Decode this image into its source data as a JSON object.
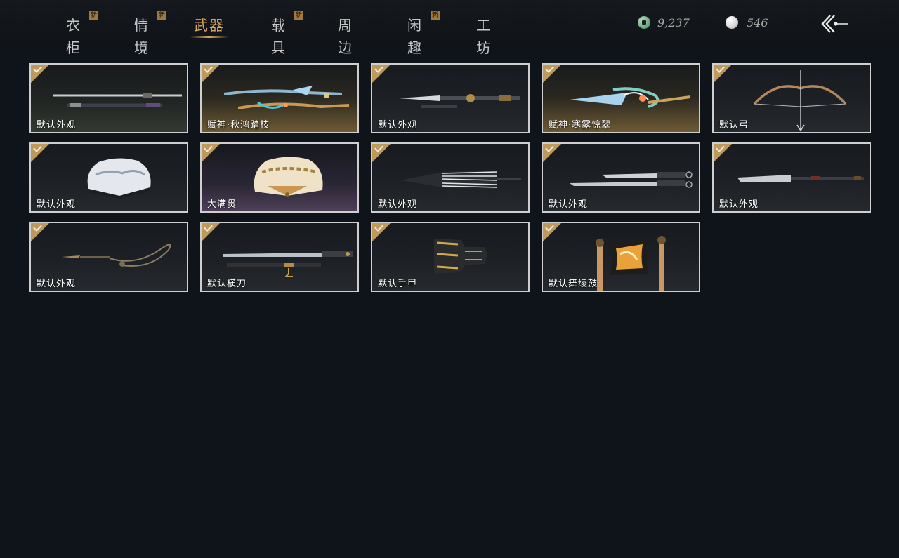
{
  "nav": {
    "tabs": [
      {
        "label": "衣柜",
        "new": true,
        "active": false
      },
      {
        "label": "情境",
        "new": true,
        "active": false
      },
      {
        "label": "武器",
        "new": false,
        "active": true
      },
      {
        "label": "载具",
        "new": true,
        "active": false
      },
      {
        "label": "周边",
        "new": false,
        "active": false
      },
      {
        "label": "闲趣",
        "new": true,
        "active": false
      },
      {
        "label": "工坊",
        "new": false,
        "active": false
      }
    ],
    "new_badge": "新"
  },
  "currencies": [
    {
      "icon": "jade-coin-icon",
      "value": "9,237"
    },
    {
      "icon": "pearl-icon",
      "value": "546"
    }
  ],
  "back_icon": "back-arrow-icon",
  "items": [
    {
      "label": "默认外观",
      "icon": "dual-sword-icon",
      "equipped": true
    },
    {
      "label": "赋神·秋鸿踏枝",
      "icon": "ornate-spear-icon",
      "equipped": true
    },
    {
      "label": "默认外观",
      "icon": "spear-icon",
      "equipped": true
    },
    {
      "label": "赋神·寒露惊翠",
      "icon": "jade-glaive-icon",
      "equipped": true
    },
    {
      "label": "默认弓",
      "icon": "bow-icon",
      "equipped": true
    },
    {
      "label": "默认外观",
      "icon": "fan-icon",
      "equipped": true
    },
    {
      "label": "大满贯",
      "icon": "golden-fan-icon",
      "equipped": true
    },
    {
      "label": "默认外观",
      "icon": "umbrella-icon",
      "equipped": true
    },
    {
      "label": "默认外观",
      "icon": "twin-blade-icon",
      "equipped": true
    },
    {
      "label": "默认外观",
      "icon": "glaive-icon",
      "equipped": true
    },
    {
      "label": "默认外观",
      "icon": "rope-dart-icon",
      "equipped": true
    },
    {
      "label": "默认横刀",
      "icon": "hengdao-sword-icon",
      "equipped": true
    },
    {
      "label": "默认手甲",
      "icon": "gauntlet-icon",
      "equipped": true
    },
    {
      "label": "默认舞绫鼓",
      "icon": "drum-icon",
      "equipped": true
    }
  ]
}
